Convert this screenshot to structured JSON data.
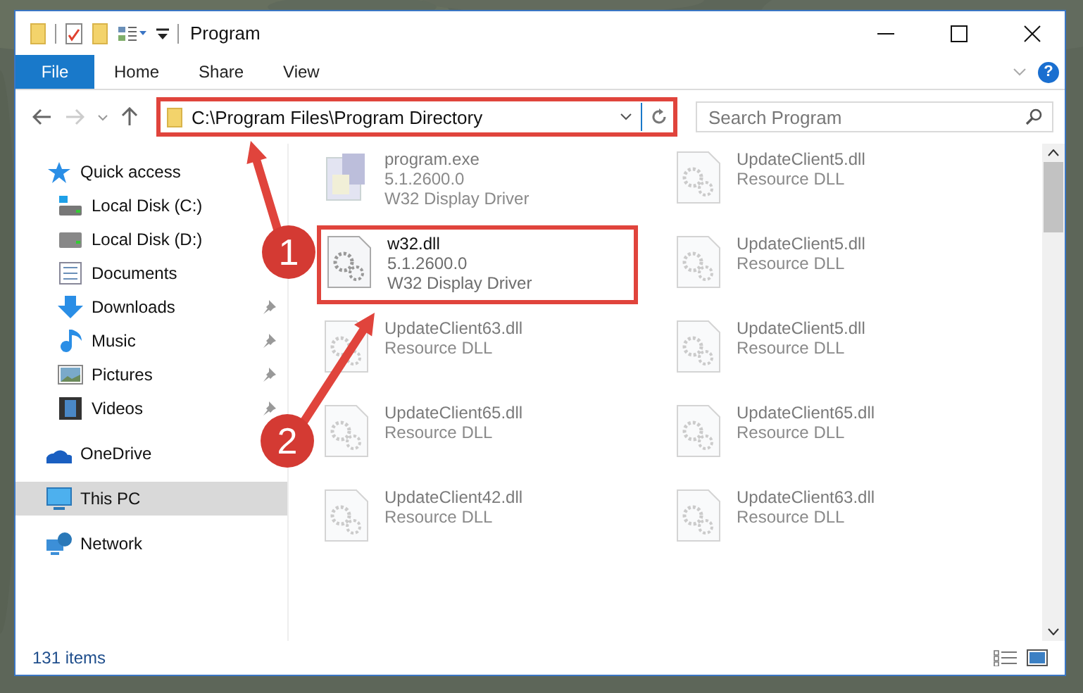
{
  "window": {
    "title": "Program"
  },
  "ribbon": {
    "tabs": [
      {
        "label": "File",
        "selected": true
      },
      {
        "label": "Home",
        "selected": false
      },
      {
        "label": "Share",
        "selected": false
      },
      {
        "label": "View",
        "selected": false
      }
    ],
    "help": "?"
  },
  "address": {
    "path": "C:\\Program Files\\Program Directory",
    "highlighted": true
  },
  "search": {
    "placeholder": "Search Program"
  },
  "sidebar": {
    "items": [
      {
        "label": "Quick access",
        "kind": "star",
        "pinned": false,
        "selected": false,
        "children": [
          {
            "label": "Local Disk (C:)",
            "kind": "disk-c",
            "pinned": false,
            "selected": false
          },
          {
            "label": "Local Disk (D:)",
            "kind": "disk",
            "pinned": false,
            "selected": false
          },
          {
            "label": "Documents",
            "kind": "doc",
            "pinned": false,
            "selected": false
          },
          {
            "label": "Downloads",
            "kind": "download",
            "pinned": true,
            "selected": false
          },
          {
            "label": "Music",
            "kind": "music",
            "pinned": true,
            "selected": false
          },
          {
            "label": "Pictures",
            "kind": "pictures",
            "pinned": true,
            "selected": false
          },
          {
            "label": "Videos",
            "kind": "videos",
            "pinned": true,
            "selected": false
          }
        ]
      },
      {
        "label": "OneDrive",
        "kind": "cloud",
        "pinned": false,
        "selected": false
      },
      {
        "label": "This PC",
        "kind": "pc",
        "pinned": false,
        "selected": true
      },
      {
        "label": "Network",
        "kind": "network",
        "pinned": false,
        "selected": false
      }
    ]
  },
  "files": [
    {
      "name": "program.exe",
      "kind": "exe",
      "lines": [
        "5.1.2600.0",
        "W32 Display Driver"
      ],
      "blurred": true,
      "highlighted": false
    },
    {
      "name": "w32.dll",
      "kind": "dll",
      "lines": [
        "5.1.2600.0",
        "W32 Display Driver"
      ],
      "blurred": false,
      "highlighted": true
    },
    {
      "name": "UpdateClient63.dll",
      "kind": "dll",
      "lines": [
        "Resource DLL"
      ],
      "blurred": true,
      "highlighted": false
    },
    {
      "name": "UpdateClient65.dll",
      "kind": "dll",
      "lines": [
        "Resource DLL"
      ],
      "blurred": true,
      "highlighted": false
    },
    {
      "name": "UpdateClient42.dll",
      "kind": "dll",
      "lines": [
        "Resource DLL"
      ],
      "blurred": true,
      "highlighted": false
    },
    {
      "name": "UpdateClient5.dll",
      "kind": "dll",
      "lines": [
        "Resource DLL"
      ],
      "blurred": true,
      "highlighted": false
    },
    {
      "name": "UpdateClient5.dll",
      "kind": "dll",
      "lines": [
        "Resource DLL"
      ],
      "blurred": true,
      "highlighted": false
    },
    {
      "name": "UpdateClient5.dll",
      "kind": "dll",
      "lines": [
        "Resource DLL"
      ],
      "blurred": true,
      "highlighted": false
    },
    {
      "name": "UpdateClient65.dll",
      "kind": "dll",
      "lines": [
        "Resource DLL"
      ],
      "blurred": true,
      "highlighted": false
    },
    {
      "name": "UpdateClient63.dll",
      "kind": "dll",
      "lines": [
        "Resource DLL"
      ],
      "blurred": true,
      "highlighted": false
    }
  ],
  "status_bar": {
    "count": "131 items"
  },
  "annotations": [
    {
      "label": "1"
    },
    {
      "label": "2"
    }
  ]
}
